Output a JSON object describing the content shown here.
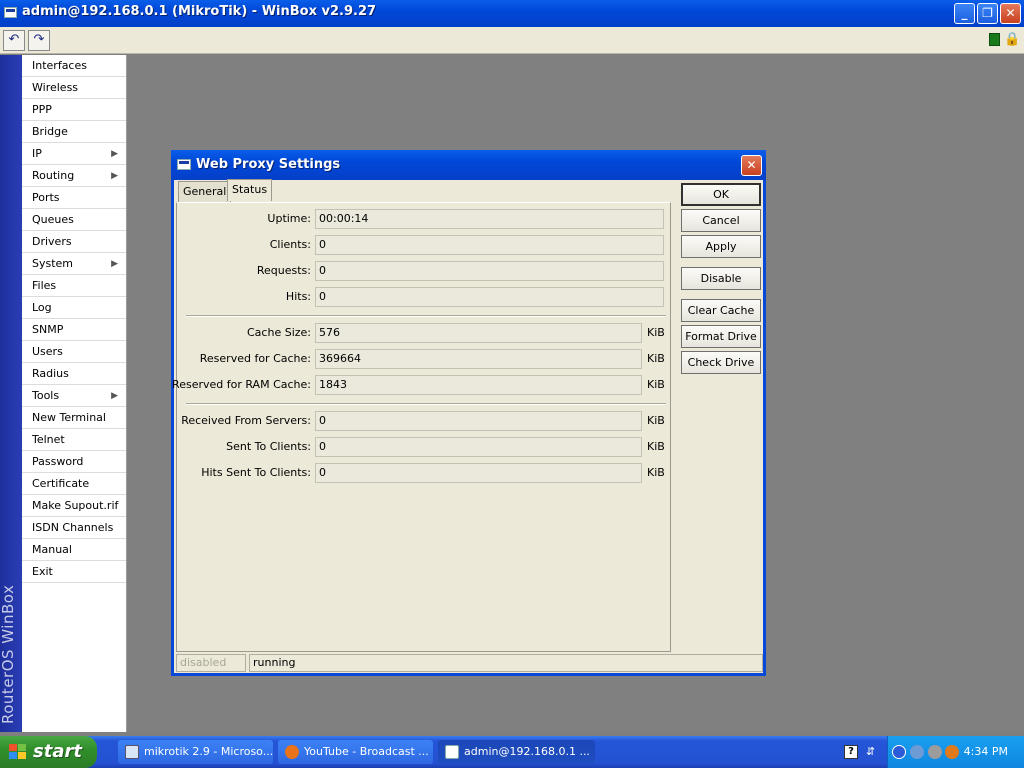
{
  "window": {
    "title": "admin@192.168.0.1 (MikroTik) - WinBox v2.9.27",
    "minimize": "_",
    "restore": "❐",
    "close": "✕"
  },
  "toolbar": {
    "undo": "↶",
    "redo": "↷"
  },
  "sidebar": {
    "brand": "RouterOS WinBox",
    "items": [
      {
        "label": "Interfaces"
      },
      {
        "label": "Wireless"
      },
      {
        "label": "PPP"
      },
      {
        "label": "Bridge"
      },
      {
        "label": "IP",
        "submenu": true
      },
      {
        "label": "Routing",
        "submenu": true
      },
      {
        "label": "Ports"
      },
      {
        "label": "Queues"
      },
      {
        "label": "Drivers"
      },
      {
        "label": "System",
        "submenu": true
      },
      {
        "label": "Files"
      },
      {
        "label": "Log"
      },
      {
        "label": "SNMP"
      },
      {
        "label": "Users"
      },
      {
        "label": "Radius"
      },
      {
        "label": "Tools",
        "submenu": true
      },
      {
        "label": "New Terminal"
      },
      {
        "label": "Telnet"
      },
      {
        "label": "Password"
      },
      {
        "label": "Certificate"
      },
      {
        "label": "Make Supout.rif"
      },
      {
        "label": "ISDN Channels"
      },
      {
        "label": "Manual"
      },
      {
        "label": "Exit"
      }
    ]
  },
  "dialog": {
    "title": "Web Proxy Settings",
    "close": "✕",
    "tabs": {
      "general": "General",
      "status": "Status"
    },
    "fields": {
      "uptime": {
        "label": "Uptime:",
        "value": "00:00:14"
      },
      "clients": {
        "label": "Clients:",
        "value": "0"
      },
      "requests": {
        "label": "Requests:",
        "value": "0"
      },
      "hits": {
        "label": "Hits:",
        "value": "0"
      },
      "cache_size": {
        "label": "Cache Size:",
        "value": "576",
        "unit": "KiB"
      },
      "reserved_cache": {
        "label": "Reserved for Cache:",
        "value": "369664",
        "unit": "KiB"
      },
      "reserved_ram": {
        "label": "Reserved for RAM Cache:",
        "value": "1843",
        "unit": "KiB"
      },
      "received_servers": {
        "label": "Received From Servers:",
        "value": "0",
        "unit": "KiB"
      },
      "sent_clients": {
        "label": "Sent To Clients:",
        "value": "0",
        "unit": "KiB"
      },
      "hits_sent": {
        "label": "Hits Sent To Clients:",
        "value": "0",
        "unit": "KiB"
      }
    },
    "buttons": {
      "ok": "OK",
      "cancel": "Cancel",
      "apply": "Apply",
      "disable": "Disable",
      "clear_cache": "Clear Cache",
      "format_drive": "Format Drive",
      "check_drive": "Check Drive"
    },
    "status": {
      "left": "disabled",
      "right": "running"
    }
  },
  "taskbar": {
    "start": "start",
    "tasks": [
      {
        "label": "mikrotik 2.9 - Microso..."
      },
      {
        "label": "YouTube - Broadcast ..."
      },
      {
        "label": "admin@192.168.0.1 ..."
      }
    ],
    "help": "?",
    "clock": "4:34 PM"
  },
  "colors": {
    "titlebar": "#0047d8",
    "desktop": "#808080",
    "dialog_bg": "#ece9d8",
    "start_green": "#318f2c"
  }
}
